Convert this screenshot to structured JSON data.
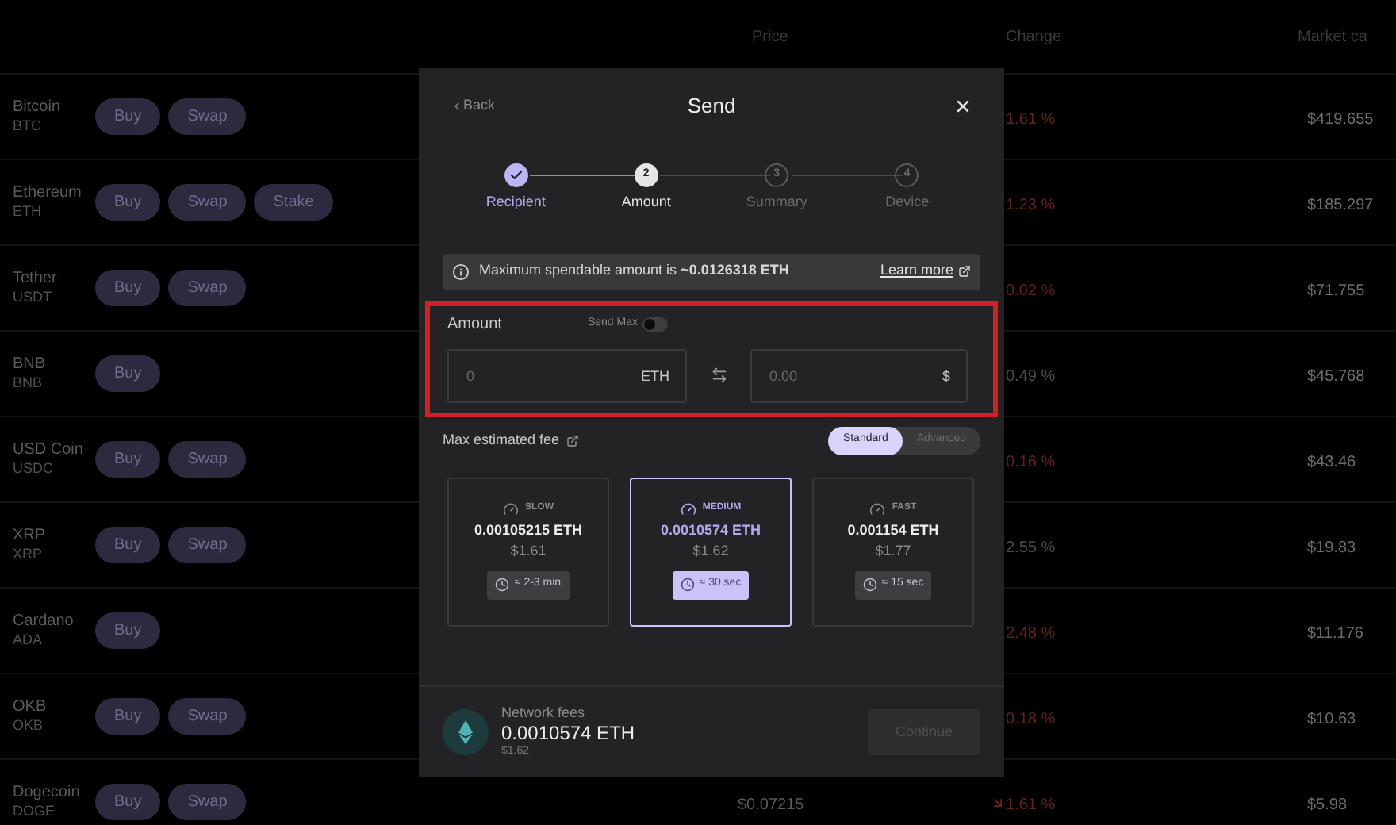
{
  "table": {
    "columns": [
      "Price",
      "Change",
      "Market ca"
    ],
    "rows": [
      {
        "name": "Bitcoin",
        "ticker": "BTC",
        "actions": [
          "Buy",
          "Swap"
        ],
        "change": "1.61 %",
        "negative": true,
        "market_cap": "$419.655"
      },
      {
        "name": "Ethereum",
        "ticker": "ETH",
        "actions": [
          "Buy",
          "Swap",
          "Stake"
        ],
        "change": "1.23 %",
        "negative": true,
        "market_cap": "$185.297"
      },
      {
        "name": "Tether",
        "ticker": "USDT",
        "actions": [
          "Buy",
          "Swap"
        ],
        "change": "0.02 %",
        "negative": true,
        "market_cap": "$71.755"
      },
      {
        "name": "BNB",
        "ticker": "BNB",
        "actions": [
          "Buy"
        ],
        "change": "0.49 %",
        "negative": false,
        "market_cap": "$45.768"
      },
      {
        "name": "USD Coin",
        "ticker": "USDC",
        "actions": [
          "Buy",
          "Swap"
        ],
        "change": "0.16 %",
        "negative": true,
        "market_cap": "$43.46"
      },
      {
        "name": "XRP",
        "ticker": "XRP",
        "actions": [
          "Buy",
          "Swap"
        ],
        "change": "2.55 %",
        "negative": false,
        "market_cap": "$19.83"
      },
      {
        "name": "Cardano",
        "ticker": "ADA",
        "actions": [
          "Buy"
        ],
        "change": "2.48 %",
        "negative": true,
        "market_cap": "$11.176"
      },
      {
        "name": "OKB",
        "ticker": "OKB",
        "actions": [
          "Buy",
          "Swap"
        ],
        "change": "0.18 %",
        "negative": true,
        "market_cap": "$10.63"
      },
      {
        "name": "Dogecoin",
        "ticker": "DOGE",
        "actions": [
          "Buy",
          "Swap"
        ],
        "price": "$0.07215",
        "change": "1.61 %",
        "negative": true,
        "market_cap": "$5.98"
      }
    ]
  },
  "modal": {
    "back": "Back",
    "title": "Send",
    "steps": [
      {
        "label": "Recipient",
        "done": true,
        "active": false
      },
      {
        "label": "Amount",
        "number": "2",
        "done": false,
        "active": true
      },
      {
        "label": "Summary",
        "number": "3",
        "done": false,
        "active": false
      },
      {
        "label": "Device",
        "number": "4",
        "done": false,
        "active": false
      }
    ],
    "notice": {
      "text": "Maximum spendable amount is **~0.0126318 ETH**",
      "link": "Learn more"
    },
    "amount": {
      "label": "Amount",
      "highlighted": true,
      "send_max": {
        "label": "Send Max",
        "on": false
      },
      "crypto": {
        "placeholder": "0",
        "unit": "ETH"
      },
      "fiat": {
        "placeholder": "0.00",
        "unit": "$"
      }
    },
    "fee": {
      "label": "Max estimated fee",
      "modes": [
        {
          "label": "Standard",
          "selected": true
        },
        {
          "label": "Advanced",
          "selected": false
        }
      ],
      "options": [
        {
          "speed": "SLOW",
          "amount": "0.00105215 ETH",
          "fiat": "$1.61",
          "time": "≈ 2-3 min",
          "selected": false
        },
        {
          "speed": "MEDIUM",
          "amount": "0.0010574 ETH",
          "fiat": "$1.62",
          "time": "≈ 30 sec",
          "selected": true
        },
        {
          "speed": "FAST",
          "amount": "0.001154 ETH",
          "fiat": "$1.77",
          "time": "≈ 15 sec",
          "selected": false
        }
      ]
    },
    "footer": {
      "label": "Network fees",
      "amount": "0.0010574 ETH",
      "fiat": "$1.62",
      "button": {
        "label": "Continue",
        "disabled": true
      }
    }
  }
}
